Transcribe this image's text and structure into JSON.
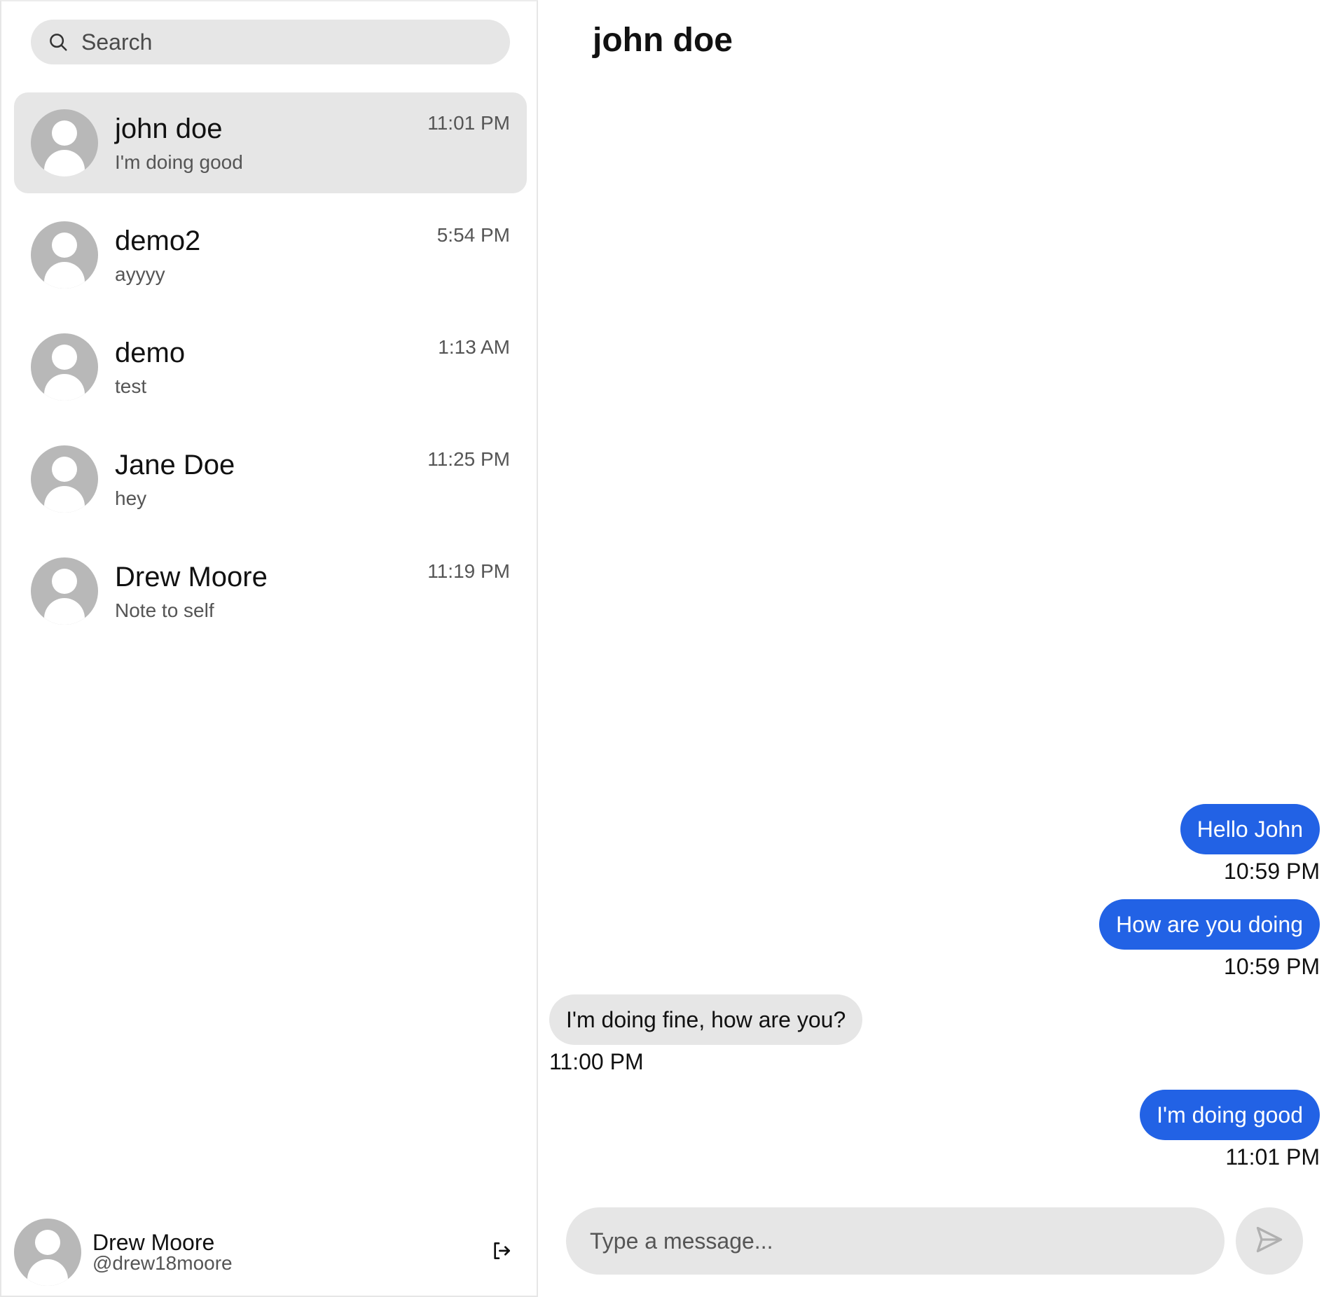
{
  "search": {
    "placeholder": "Search",
    "icon": "search-icon"
  },
  "conversations": [
    {
      "name": "john doe",
      "preview": "I'm doing good",
      "time": "11:01 PM",
      "active": true
    },
    {
      "name": "demo2",
      "preview": "ayyyy",
      "time": "5:54 PM",
      "active": false
    },
    {
      "name": "demo",
      "preview": "test",
      "time": "1:13 AM",
      "active": false
    },
    {
      "name": "Jane Doe",
      "preview": "hey",
      "time": "11:25 PM",
      "active": false
    },
    {
      "name": "Drew Moore",
      "preview": "Note to self",
      "time": "11:19 PM",
      "active": false
    }
  ],
  "profile": {
    "name": "Drew Moore",
    "handle": "@drew18moore",
    "logout_icon": "logout-icon"
  },
  "chat": {
    "title": "john doe",
    "messages": [
      {
        "text": "Hello John",
        "time": "10:59 PM",
        "direction": "outgoing"
      },
      {
        "text": "How are you doing",
        "time": "10:59 PM",
        "direction": "outgoing"
      },
      {
        "text": "I'm doing fine, how are you?",
        "time": "11:00 PM",
        "direction": "incoming"
      },
      {
        "text": "I'm doing good",
        "time": "11:01 PM",
        "direction": "outgoing"
      }
    ],
    "composer": {
      "placeholder": "Type a message...",
      "send_icon": "send-icon"
    }
  },
  "colors": {
    "accent": "#2262e5",
    "bubble_incoming": "#e6e6e6",
    "active_row": "#e6e6e6",
    "avatar_placeholder": "#b8b8b8"
  }
}
